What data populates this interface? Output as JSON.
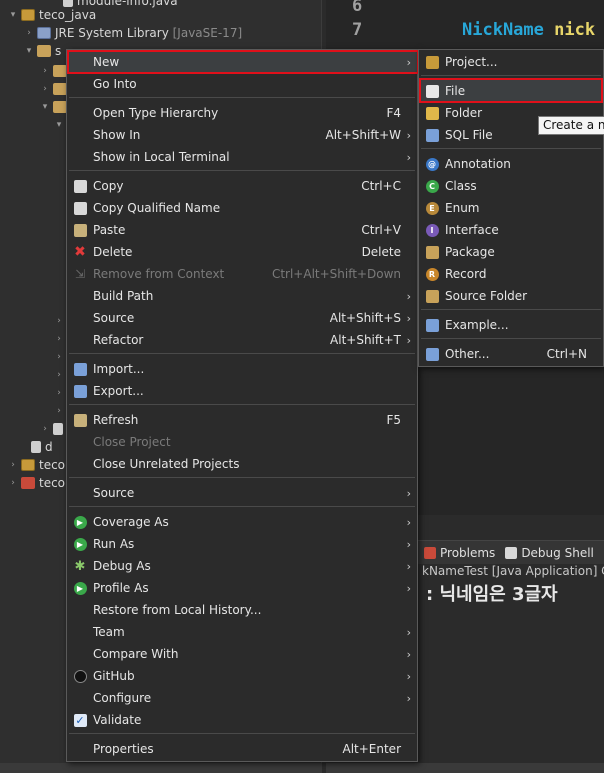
{
  "explorer": {
    "rows": [
      {
        "label": "module-info.java"
      },
      {
        "label": "teco_java"
      },
      {
        "label": "JRE System Library",
        "sub": "[JavaSE-17]"
      },
      {
        "label": "s"
      },
      {
        "label": "d"
      },
      {
        "label": "teco"
      },
      {
        "label": "teco"
      }
    ]
  },
  "editor": {
    "line_numbers": [
      "6",
      "7"
    ],
    "code_type": "NickName",
    "code_var": "nick"
  },
  "context_menu": {
    "items": [
      {
        "label": "New",
        "shortcut": "",
        "submenu": true
      },
      {
        "label": "Go Into",
        "shortcut": ""
      },
      {
        "label": "Open Type Hierarchy",
        "shortcut": "F4"
      },
      {
        "label": "Show In",
        "shortcut": "Alt+Shift+W",
        "submenu": true
      },
      {
        "label": "Show in Local Terminal",
        "shortcut": "",
        "submenu": true
      },
      {
        "label": "Copy",
        "shortcut": "Ctrl+C"
      },
      {
        "label": "Copy Qualified Name",
        "shortcut": ""
      },
      {
        "label": "Paste",
        "shortcut": "Ctrl+V"
      },
      {
        "label": "Delete",
        "shortcut": "Delete"
      },
      {
        "label": "Remove from Context",
        "shortcut": "Ctrl+Alt+Shift+Down"
      },
      {
        "label": "Build Path",
        "shortcut": "",
        "submenu": true
      },
      {
        "label": "Source",
        "shortcut": "Alt+Shift+S",
        "submenu": true
      },
      {
        "label": "Refactor",
        "shortcut": "Alt+Shift+T",
        "submenu": true
      },
      {
        "label": "Import...",
        "shortcut": ""
      },
      {
        "label": "Export...",
        "shortcut": ""
      },
      {
        "label": "Refresh",
        "shortcut": "F5"
      },
      {
        "label": "Close Project",
        "shortcut": ""
      },
      {
        "label": "Close Unrelated Projects",
        "shortcut": ""
      },
      {
        "label": "Source",
        "shortcut": "",
        "submenu": true
      },
      {
        "label": "Coverage As",
        "shortcut": "",
        "submenu": true
      },
      {
        "label": "Run As",
        "shortcut": "",
        "submenu": true
      },
      {
        "label": "Debug As",
        "shortcut": "",
        "submenu": true
      },
      {
        "label": "Profile As",
        "shortcut": "",
        "submenu": true
      },
      {
        "label": "Restore from Local History...",
        "shortcut": ""
      },
      {
        "label": "Team",
        "shortcut": "",
        "submenu": true
      },
      {
        "label": "Compare With",
        "shortcut": "",
        "submenu": true
      },
      {
        "label": "GitHub",
        "shortcut": "",
        "submenu": true
      },
      {
        "label": "Configure",
        "shortcut": "",
        "submenu": true
      },
      {
        "label": "Validate",
        "shortcut": ""
      },
      {
        "label": "Properties",
        "shortcut": "Alt+Enter"
      }
    ]
  },
  "new_submenu": {
    "items": [
      {
        "label": "Project...",
        "shortcut": ""
      },
      {
        "label": "File",
        "shortcut": ""
      },
      {
        "label": "Folder",
        "shortcut": ""
      },
      {
        "label": "SQL File",
        "shortcut": ""
      },
      {
        "label": "Annotation",
        "shortcut": ""
      },
      {
        "label": "Class",
        "shortcut": ""
      },
      {
        "label": "Enum",
        "shortcut": ""
      },
      {
        "label": "Interface",
        "shortcut": ""
      },
      {
        "label": "Package",
        "shortcut": ""
      },
      {
        "label": "Record",
        "shortcut": ""
      },
      {
        "label": "Source Folder",
        "shortcut": ""
      },
      {
        "label": "Example...",
        "shortcut": ""
      },
      {
        "label": "Other...",
        "shortcut": "Ctrl+N"
      }
    ]
  },
  "tooltip": {
    "text": "Create a ne"
  },
  "console": {
    "tab_problems": "Problems",
    "tab_debug_shell": "Debug Shell",
    "description": "kNameTest [Java Application] C:\\",
    "output": ": 닉네임은 3글자"
  },
  "colors": {
    "highlight_border": "#e0101a",
    "menu_bg": "#2b2b2b",
    "keyword_blue": "#28a7d8",
    "keyword_yellow": "#e8d66a"
  }
}
